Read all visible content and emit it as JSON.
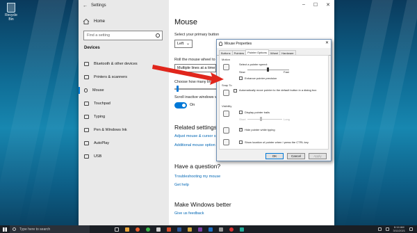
{
  "desktop": {
    "recycle_bin_label": "Recycle Bin"
  },
  "settings": {
    "window_title": "Settings",
    "home_label": "Home",
    "search_placeholder": "Find a setting",
    "section_title": "Devices",
    "nav_items": [
      "Bluetooth & other devices",
      "Printers & scanners",
      "Mouse",
      "Touchpad",
      "Typing",
      "Pen & Windows Ink",
      "AutoPlay",
      "USB"
    ],
    "active_nav_index": 2,
    "page_title": "Mouse",
    "primary_button_label": "Select your primary button",
    "primary_button_value": "Left",
    "roll_wheel_label": "Roll the mouse wheel to",
    "roll_wheel_value": "Multiple lines at a time",
    "lines_label": "Choose how many lines",
    "scroll_inactive_label": "Scroll inactive windows w",
    "scroll_inactive_state": "On",
    "related_title": "Related settings",
    "related_links": [
      "Adjust mouse & cursor s",
      "Additional mouse option"
    ],
    "question_title": "Have a question?",
    "question_links": [
      "Troubleshooting my mouse",
      "Get help"
    ],
    "better_title": "Make Windows better",
    "better_link": "Give us feedback"
  },
  "dialog": {
    "title": "Mouse Properties",
    "tabs": [
      "Buttons",
      "Pointers",
      "Pointer Options",
      "Wheel",
      "Hardware"
    ],
    "selected_tab": "Pointer Options",
    "motion_group": "Motion",
    "speed_label": "Select a pointer speed:",
    "slow_label": "Slow",
    "fast_label": "Fast",
    "enhance_label": "Enhance pointer precision",
    "enhance_checked": false,
    "snap_group": "Snap To",
    "snap_label": "Automatically move pointer to the default button in a dialog box",
    "snap_checked": false,
    "visibility_group": "Visibility",
    "trails_label": "Display pointer trails",
    "trails_checked": false,
    "short_label": "Short",
    "long_label": "Long",
    "hide_label": "Hide pointer while typing",
    "hide_checked": true,
    "ctrl_label": "Show location of pointer when I press the CTRL key",
    "ctrl_checked": false,
    "ok_label": "OK",
    "cancel_label": "Cancel",
    "apply_label": "Apply"
  },
  "taskbar": {
    "search_placeholder": "Type here to search",
    "clock_time": "6:14 AM",
    "clock_date": "3/11/2021"
  },
  "colors": {
    "accent": "#0078d7",
    "arrow": "#e0261c"
  }
}
